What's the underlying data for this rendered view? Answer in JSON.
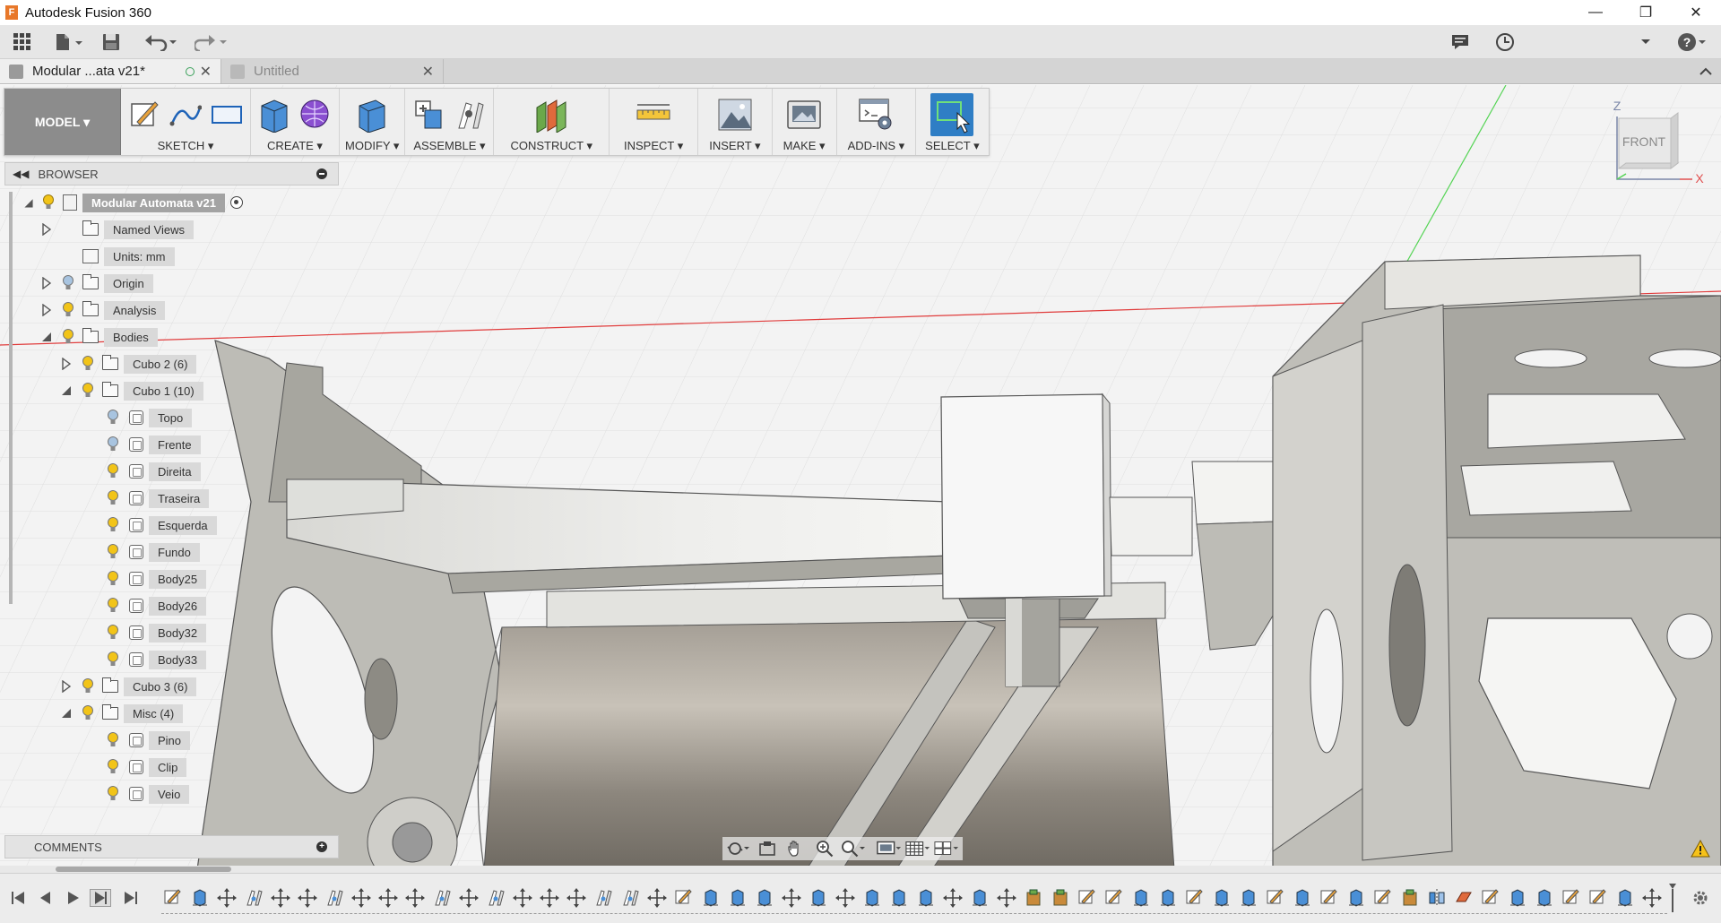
{
  "window": {
    "title": "Autodesk Fusion 360",
    "app_icon_letter": "F"
  },
  "tabs": [
    {
      "label": "Modular ...ata v21*",
      "active": true
    },
    {
      "label": "Untitled",
      "active": false
    }
  ],
  "ribbon": {
    "workspace": "MODEL ▾",
    "groups": [
      {
        "label": "SKETCH ▾",
        "icons": [
          "create-sketch-icon",
          "spline-icon",
          "rectangle-icon"
        ]
      },
      {
        "label": "CREATE ▾",
        "icons": [
          "extrude-icon",
          "form-icon"
        ]
      },
      {
        "label": "MODIFY ▾",
        "icons": [
          "press-pull-icon"
        ]
      },
      {
        "label": "ASSEMBLE ▾",
        "icons": [
          "new-component-icon",
          "joint-icon"
        ]
      },
      {
        "label": "CONSTRUCT ▾",
        "icons": [
          "offset-plane-icon"
        ]
      },
      {
        "label": "INSPECT ▾",
        "icons": [
          "measure-icon"
        ]
      },
      {
        "label": "INSERT ▾",
        "icons": [
          "insert-image-icon"
        ]
      },
      {
        "label": "MAKE ▾",
        "icons": [
          "make-icon"
        ]
      },
      {
        "label": "ADD-INS ▾",
        "icons": [
          "scripts-icon"
        ]
      },
      {
        "label": "SELECT ▾",
        "icons": [
          "select-icon"
        ]
      }
    ]
  },
  "browser": {
    "title": "BROWSER",
    "root": "Modular Automata v21",
    "items": [
      {
        "label": "Named Views",
        "level": 1,
        "expander": "closed",
        "bulb": null,
        "icon": "folder"
      },
      {
        "label": "Units: mm",
        "level": 1,
        "expander": null,
        "bulb": null,
        "icon": "units"
      },
      {
        "label": "Origin",
        "level": 1,
        "expander": "closed",
        "bulb": "off",
        "icon": "folder"
      },
      {
        "label": "Analysis",
        "level": 1,
        "expander": "closed",
        "bulb": "on",
        "icon": "folder"
      },
      {
        "label": "Bodies",
        "level": 1,
        "expander": "open",
        "bulb": "on",
        "icon": "folder"
      },
      {
        "label": "Cubo 2 (6)",
        "level": 2,
        "expander": "closed",
        "bulb": "on",
        "icon": "folder"
      },
      {
        "label": "Cubo 1 (10)",
        "level": 2,
        "expander": "open",
        "bulb": "on",
        "icon": "folder"
      },
      {
        "label": "Topo",
        "level": 3,
        "expander": null,
        "bulb": "off",
        "icon": "body"
      },
      {
        "label": "Frente",
        "level": 3,
        "expander": null,
        "bulb": "off",
        "icon": "body"
      },
      {
        "label": "Direita",
        "level": 3,
        "expander": null,
        "bulb": "on",
        "icon": "body"
      },
      {
        "label": "Traseira",
        "level": 3,
        "expander": null,
        "bulb": "on",
        "icon": "body"
      },
      {
        "label": "Esquerda",
        "level": 3,
        "expander": null,
        "bulb": "on",
        "icon": "body"
      },
      {
        "label": "Fundo",
        "level": 3,
        "expander": null,
        "bulb": "on",
        "icon": "body"
      },
      {
        "label": "Body25",
        "level": 3,
        "expander": null,
        "bulb": "on",
        "icon": "body"
      },
      {
        "label": "Body26",
        "level": 3,
        "expander": null,
        "bulb": "on",
        "icon": "body"
      },
      {
        "label": "Body32",
        "level": 3,
        "expander": null,
        "bulb": "on",
        "icon": "body"
      },
      {
        "label": "Body33",
        "level": 3,
        "expander": null,
        "bulb": "on",
        "icon": "body"
      },
      {
        "label": "Cubo 3 (6)",
        "level": 2,
        "expander": "closed",
        "bulb": "on",
        "icon": "folder"
      },
      {
        "label": "Misc (4)",
        "level": 2,
        "expander": "open",
        "bulb": "on",
        "icon": "folder"
      },
      {
        "label": "Pino",
        "level": 3,
        "expander": null,
        "bulb": "on",
        "icon": "body"
      },
      {
        "label": "Clip",
        "level": 3,
        "expander": null,
        "bulb": "on",
        "icon": "body"
      },
      {
        "label": "Veio",
        "level": 3,
        "expander": null,
        "bulb": "on",
        "icon": "body"
      }
    ]
  },
  "comments": {
    "title": "COMMENTS"
  },
  "viewcube": {
    "face": "FRONT",
    "axis_z": "Z",
    "axis_x": "X"
  },
  "colors": {
    "bulb_on": "#f2c418",
    "bulb_off": "#a8c4e0",
    "select_active": "#2f7ec5",
    "x_axis": "#e03c3c",
    "y_axis": "#55d455"
  },
  "timeline": {
    "features": [
      "sketch",
      "extrude",
      "move",
      "joint",
      "move",
      "move",
      "joint",
      "move",
      "move",
      "move",
      "joint",
      "move",
      "joint",
      "move",
      "move",
      "move",
      "joint",
      "joint",
      "move",
      "sketch",
      "extrude",
      "extrude",
      "extrude",
      "move",
      "extrude",
      "move",
      "extrude",
      "extrude",
      "extrude",
      "move",
      "extrude",
      "move",
      "component",
      "component",
      "sketch",
      "sketch",
      "extrude",
      "extrude",
      "sketch",
      "extrude",
      "extrude",
      "sketch",
      "extrude",
      "sketch",
      "extrude",
      "sketch",
      "component",
      "mirror",
      "plane",
      "sketch",
      "extrude",
      "extrude",
      "sketch",
      "sketch",
      "extrude",
      "move"
    ]
  }
}
